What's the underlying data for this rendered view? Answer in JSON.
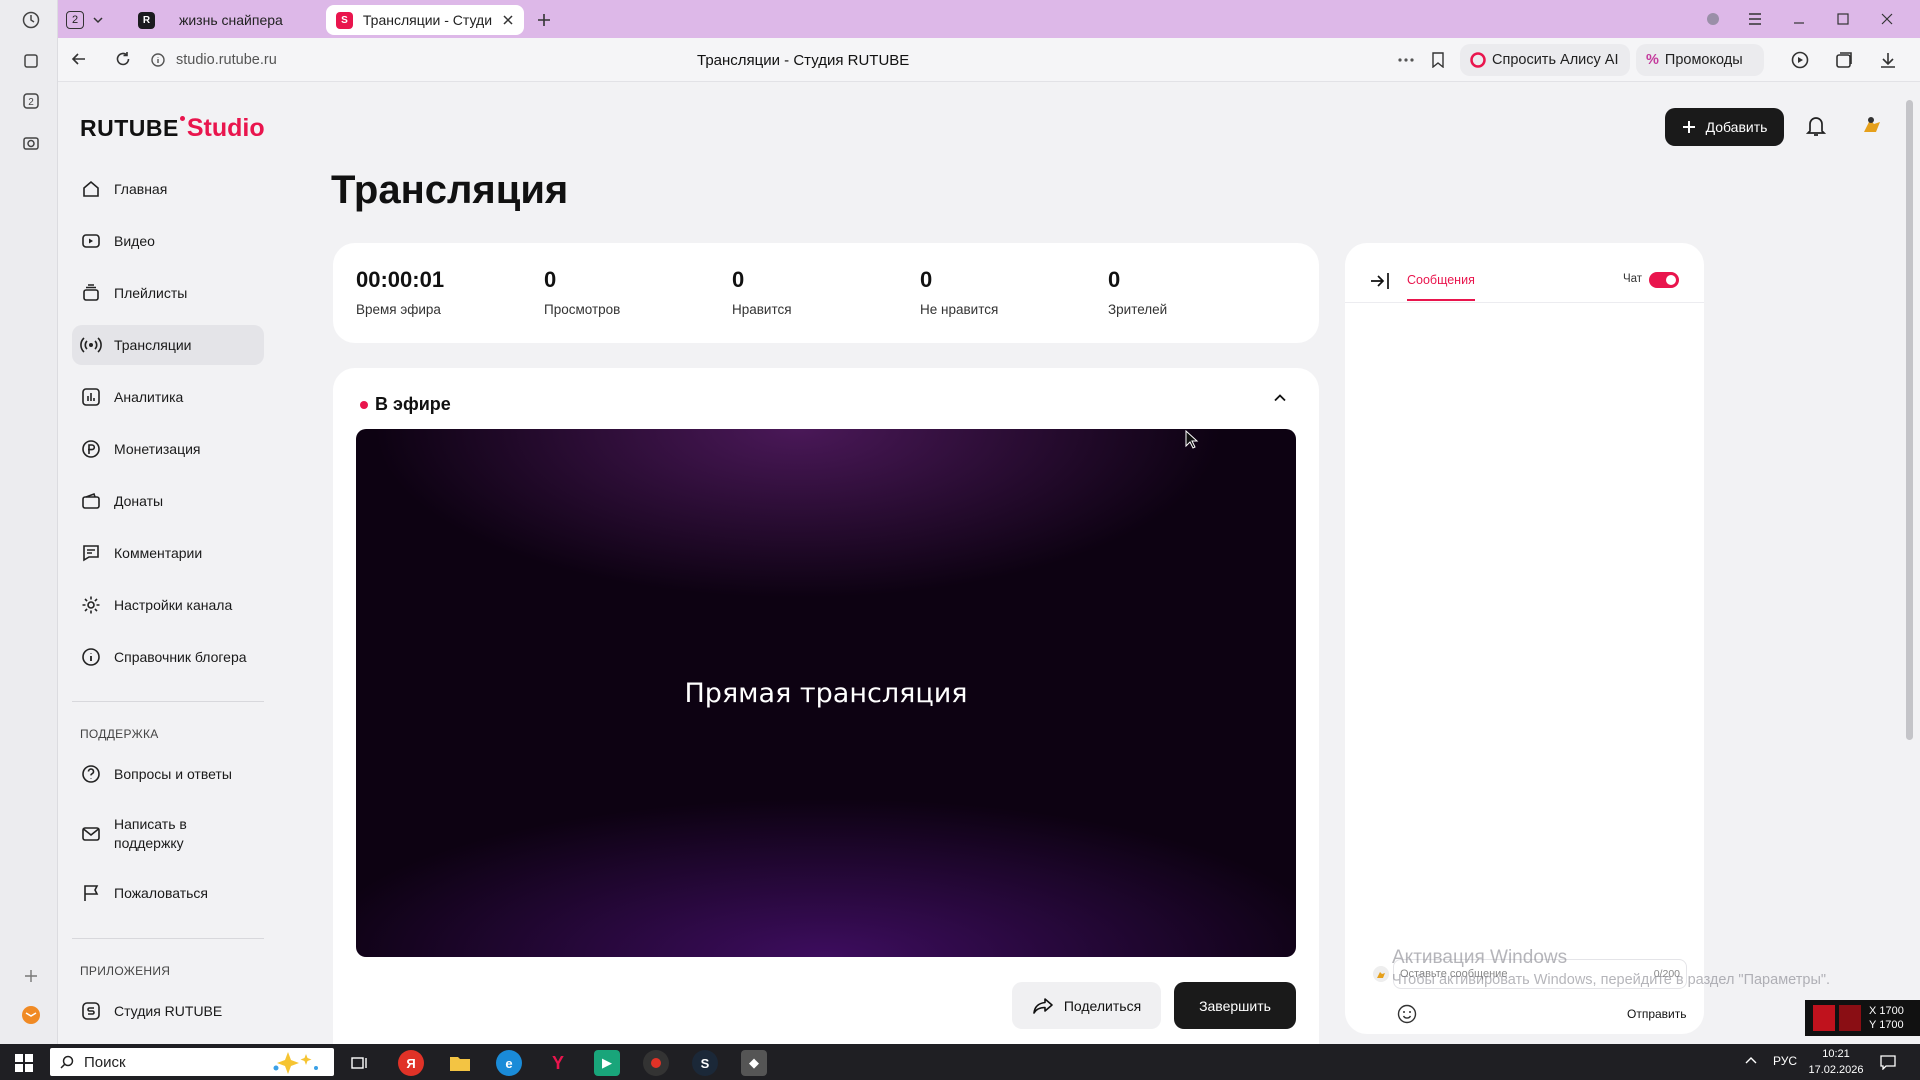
{
  "browser": {
    "tab_count": "2",
    "tabs": [
      {
        "title": "жизнь снайпера",
        "favicon": "rutube-favicon",
        "active": false
      },
      {
        "title": "Трансляции - Студия R",
        "favicon": "studio-favicon",
        "active": true
      }
    ],
    "url": "studio.rutube.ru",
    "page_title": "Трансляции - Студия RUTUBE",
    "alice_label": "Спросить Алису AI",
    "promo_label": "Промокоды"
  },
  "app": {
    "logo_main": "RUTUBE",
    "logo_sub": "Studio",
    "add_button": "Добавить",
    "colors": {
      "accent": "#e9154d",
      "dark": "#1a1a1a",
      "tab_strip": "#ddb8e8"
    }
  },
  "sidebar": {
    "items": [
      {
        "label": "Главная",
        "icon": "home-icon"
      },
      {
        "label": "Видео",
        "icon": "video-icon"
      },
      {
        "label": "Плейлисты",
        "icon": "playlist-icon"
      },
      {
        "label": "Трансляции",
        "icon": "broadcast-icon",
        "active": true
      },
      {
        "label": "Аналитика",
        "icon": "analytics-icon"
      },
      {
        "label": "Монетизация",
        "icon": "monetization-icon"
      },
      {
        "label": "Донаты",
        "icon": "wallet-icon"
      },
      {
        "label": "Комментарии",
        "icon": "comment-icon"
      },
      {
        "label": "Настройки канала",
        "icon": "gear-icon"
      },
      {
        "label": "Справочник блогера",
        "icon": "info-icon"
      }
    ],
    "support_title": "ПОДДЕРЖКА",
    "support_items": [
      {
        "label": "Вопросы и ответы",
        "icon": "question-icon"
      },
      {
        "label": "Написать в поддержку",
        "icon": "mail-icon"
      },
      {
        "label": "Пожаловаться",
        "icon": "flag-icon"
      }
    ],
    "apps_title": "ПРИЛОЖЕНИЯ",
    "apps_items": [
      {
        "label": "Студия RUTUBE",
        "icon": "studio-app-icon"
      }
    ]
  },
  "main": {
    "title": "Трансляция",
    "stats": [
      {
        "value": "00:00:01",
        "label": "Время эфира"
      },
      {
        "value": "0",
        "label": "Просмотров"
      },
      {
        "value": "0",
        "label": "Нравится"
      },
      {
        "value": "0",
        "label": "Не нравится"
      },
      {
        "value": "0",
        "label": "Зрителей"
      }
    ],
    "live_status": "В эфире",
    "player_text": "Прямая трансляция",
    "share_button": "Поделиться",
    "finish_button": "Завершить"
  },
  "chat": {
    "tab_label": "Сообщения",
    "toggle_label": "Чат",
    "toggle_on": true,
    "input_placeholder": "Оставьте сообщение",
    "char_count": "0/200",
    "send_label": "Отправить"
  },
  "watermark": {
    "line1": "Активация Windows",
    "line2": "Чтобы активировать Windows, перейдите в раздел \"Параметры\"."
  },
  "overlay": {
    "x": "X 1700",
    "y": "Y 1700"
  },
  "taskbar": {
    "search_placeholder": "Поиск",
    "lang": "РУС",
    "time": "10:21",
    "date": "17.02.2026"
  }
}
